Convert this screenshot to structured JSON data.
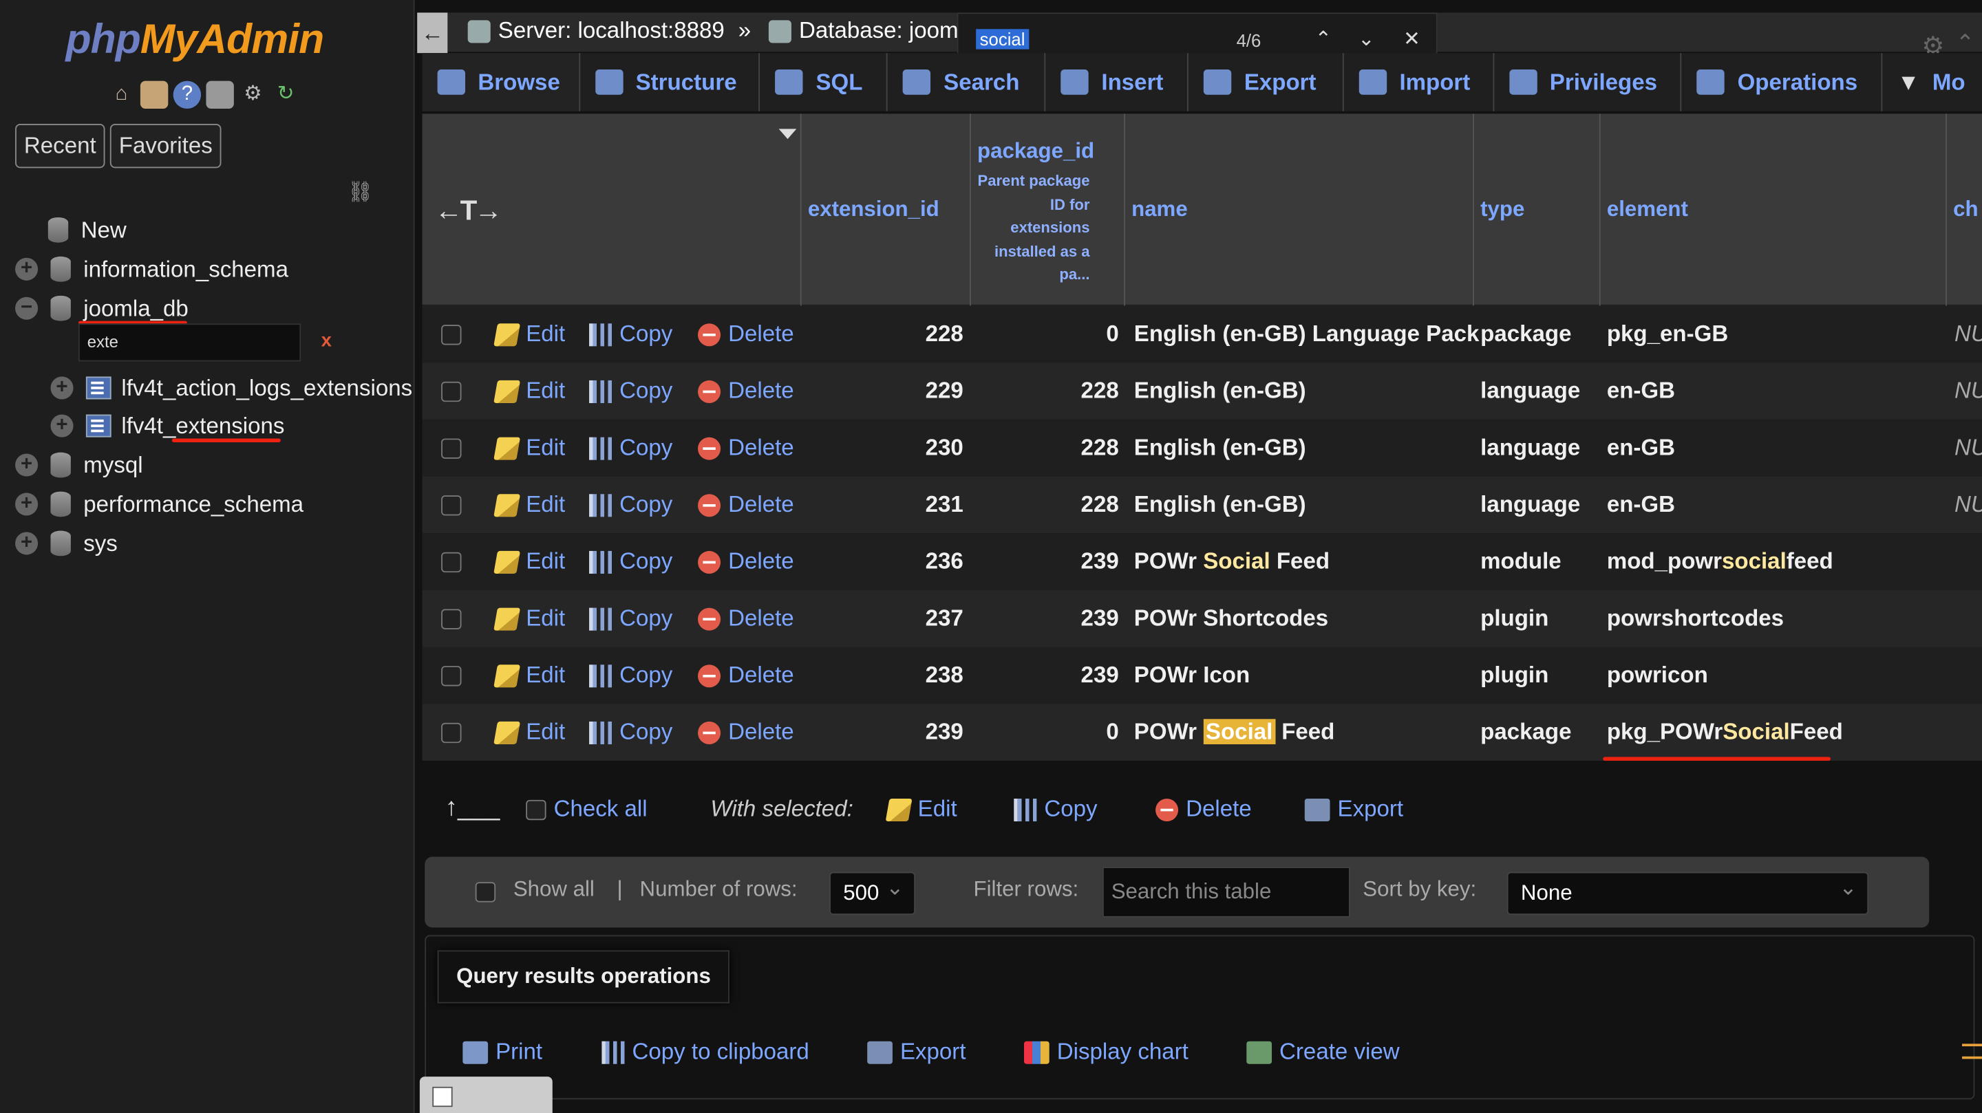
{
  "app": {
    "logo_php": "php",
    "logo_my": "MyAdmin"
  },
  "sidebar": {
    "recent": "Recent",
    "favorites": "Favorites",
    "new": "New",
    "dbs": [
      "information_schema",
      "joomla_db",
      "mysql",
      "performance_schema",
      "sys"
    ],
    "filter_value": "exte",
    "clear": "x",
    "tables": [
      "lfv4t_action_logs_extensions",
      "lfv4t_extensions"
    ]
  },
  "breadcrumb": {
    "server": "Server: localhost:8889",
    "sep": "»",
    "database": "Database: joom"
  },
  "find": {
    "query": "social",
    "count": "4/6"
  },
  "tabs": [
    "Browse",
    "Structure",
    "SQL",
    "Search",
    "Insert",
    "Export",
    "Import",
    "Privileges",
    "Operations",
    "Mo"
  ],
  "columns": {
    "toggle": "←T→",
    "extension_id": "extension_id",
    "package_id": "package_id",
    "package_id_comment": "Parent package ID for extensions installed as a pa...",
    "name": "name",
    "type": "type",
    "element": "element",
    "ch": "ch"
  },
  "actions": {
    "edit": "Edit",
    "copy": "Copy",
    "delete": "Delete"
  },
  "rows": [
    {
      "ext": "228",
      "pkg": "0",
      "name": "English (en-GB) Language Pack",
      "type": "package",
      "element": "pkg_en-GB",
      "extra": "NU"
    },
    {
      "ext": "229",
      "pkg": "228",
      "name": "English (en-GB)",
      "type": "language",
      "element": "en-GB",
      "extra": "NU"
    },
    {
      "ext": "230",
      "pkg": "228",
      "name": "English (en-GB)",
      "type": "language",
      "element": "en-GB",
      "extra": "NU"
    },
    {
      "ext": "231",
      "pkg": "228",
      "name": "English (en-GB)",
      "type": "language",
      "element": "en-GB",
      "extra": "NU"
    },
    {
      "ext": "236",
      "pkg": "239",
      "name_pre": "POWr ",
      "name_hl": "Social",
      "name_post": " Feed",
      "type": "module",
      "element_pre": "mod_powr",
      "element_hl": "social",
      "element_post": "feed",
      "extra": ""
    },
    {
      "ext": "237",
      "pkg": "239",
      "name": "POWr Shortcodes",
      "type": "plugin",
      "element": "powrshortcodes",
      "extra": ""
    },
    {
      "ext": "238",
      "pkg": "239",
      "name": "POWr Icon",
      "type": "plugin",
      "element": "powricon",
      "extra": ""
    },
    {
      "ext": "239",
      "pkg": "0",
      "name_pre": "POWr ",
      "name_hl": "Social",
      "name_post": " Feed",
      "type": "package",
      "element_pre": "pkg_POWr",
      "element_hl": "Social",
      "element_post": "Feed",
      "extra": ""
    }
  ],
  "bulk": {
    "check_all": "Check all",
    "with_selected": "With selected:",
    "edit": "Edit",
    "copy": "Copy",
    "delete": "Delete",
    "export": "Export"
  },
  "nav": {
    "show_all": "Show all",
    "sep": "|",
    "rows_label": "Number of rows:",
    "rows_value": "500",
    "filter_label": "Filter rows:",
    "filter_placeholder": "Search this table",
    "sort_label": "Sort by key:",
    "sort_value": "None"
  },
  "query_ops": {
    "title": "Query results operations",
    "print": "Print",
    "copy_clipboard": "Copy to clipboard",
    "export": "Export",
    "display_chart": "Display chart",
    "create_view": "Create view"
  }
}
